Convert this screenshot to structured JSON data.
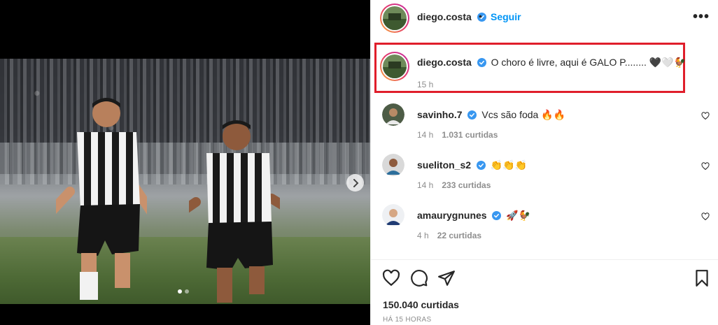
{
  "post": {
    "author": "diego.costa",
    "follow_label": "Seguir",
    "separator": "•",
    "more_label": "•••",
    "caption": "O choro é livre, aqui é GALO P........ 🖤🤍🐓",
    "caption_time": "15 h",
    "likes_label": "150.040 curtidas",
    "posted_ago": "HÁ 15 HORAS",
    "carousel": {
      "total_slides": 2,
      "active_slide": 1
    }
  },
  "comments": [
    {
      "username": "savinho.7",
      "verified": true,
      "text": "Vcs são foda 🔥🔥",
      "time": "14 h",
      "likes": "1.031 curtidas"
    },
    {
      "username": "sueliton_s2",
      "verified": true,
      "text": "👏👏👏",
      "time": "14 h",
      "likes": "233 curtidas"
    },
    {
      "username": "amaurygnunes",
      "verified": true,
      "text": "🚀🐓",
      "time": "4 h",
      "likes": "22 curtidas"
    }
  ],
  "icons": {
    "like": "heart-icon",
    "comment": "comment-bubble-icon",
    "share": "paper-plane-icon",
    "save": "bookmark-icon",
    "next": "chevron-right-icon",
    "verified": "verified-badge-icon"
  },
  "colors": {
    "accent": "#0095f6",
    "verified": "#3897f0",
    "highlight_box": "#e01e2b",
    "muted": "#8e8e8e"
  }
}
